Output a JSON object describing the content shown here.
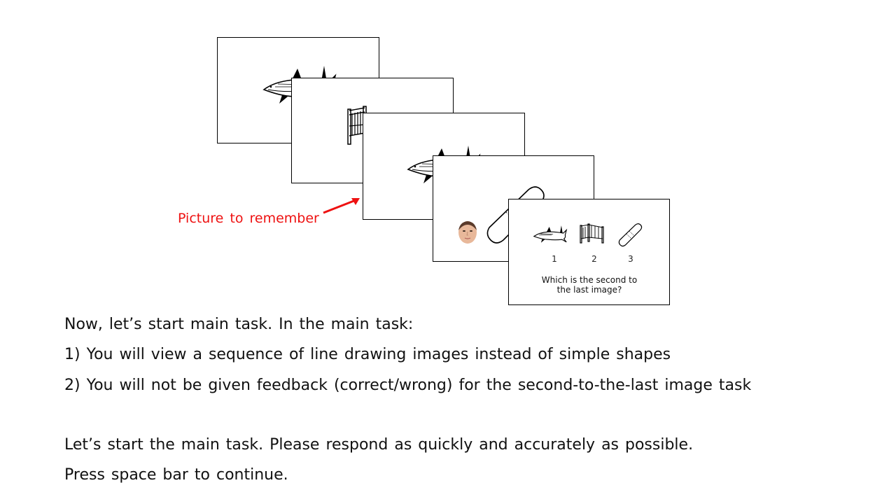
{
  "slide": {
    "callout_label": "Picture to remember",
    "accent_color": "#ee1111",
    "cards": [
      {
        "content": "shark-drawing"
      },
      {
        "content": "crib-drawing"
      },
      {
        "content": "shark-drawing"
      },
      {
        "content": "face-and-bandage-drawing"
      },
      {
        "content": "response-screen",
        "choices": [
          {
            "number": "1",
            "image": "shark-drawing"
          },
          {
            "number": "2",
            "image": "crib-drawing"
          },
          {
            "number": "3",
            "image": "bandage-drawing"
          }
        ],
        "question_line1": "Which is the second to",
        "question_line2": "the last image?"
      }
    ]
  },
  "instructions": {
    "line1": "Now, let’s start main task. In the main task:",
    "line2": "1) You will view a sequence of line drawing images instead of simple shapes",
    "line3": "2) You will not be given feedback (correct/wrong) for the second-to-the-last image task",
    "line4": "Let’s start the main task. Please respond as quickly and accurately as possible.",
    "line5": "Press space bar to continue."
  }
}
